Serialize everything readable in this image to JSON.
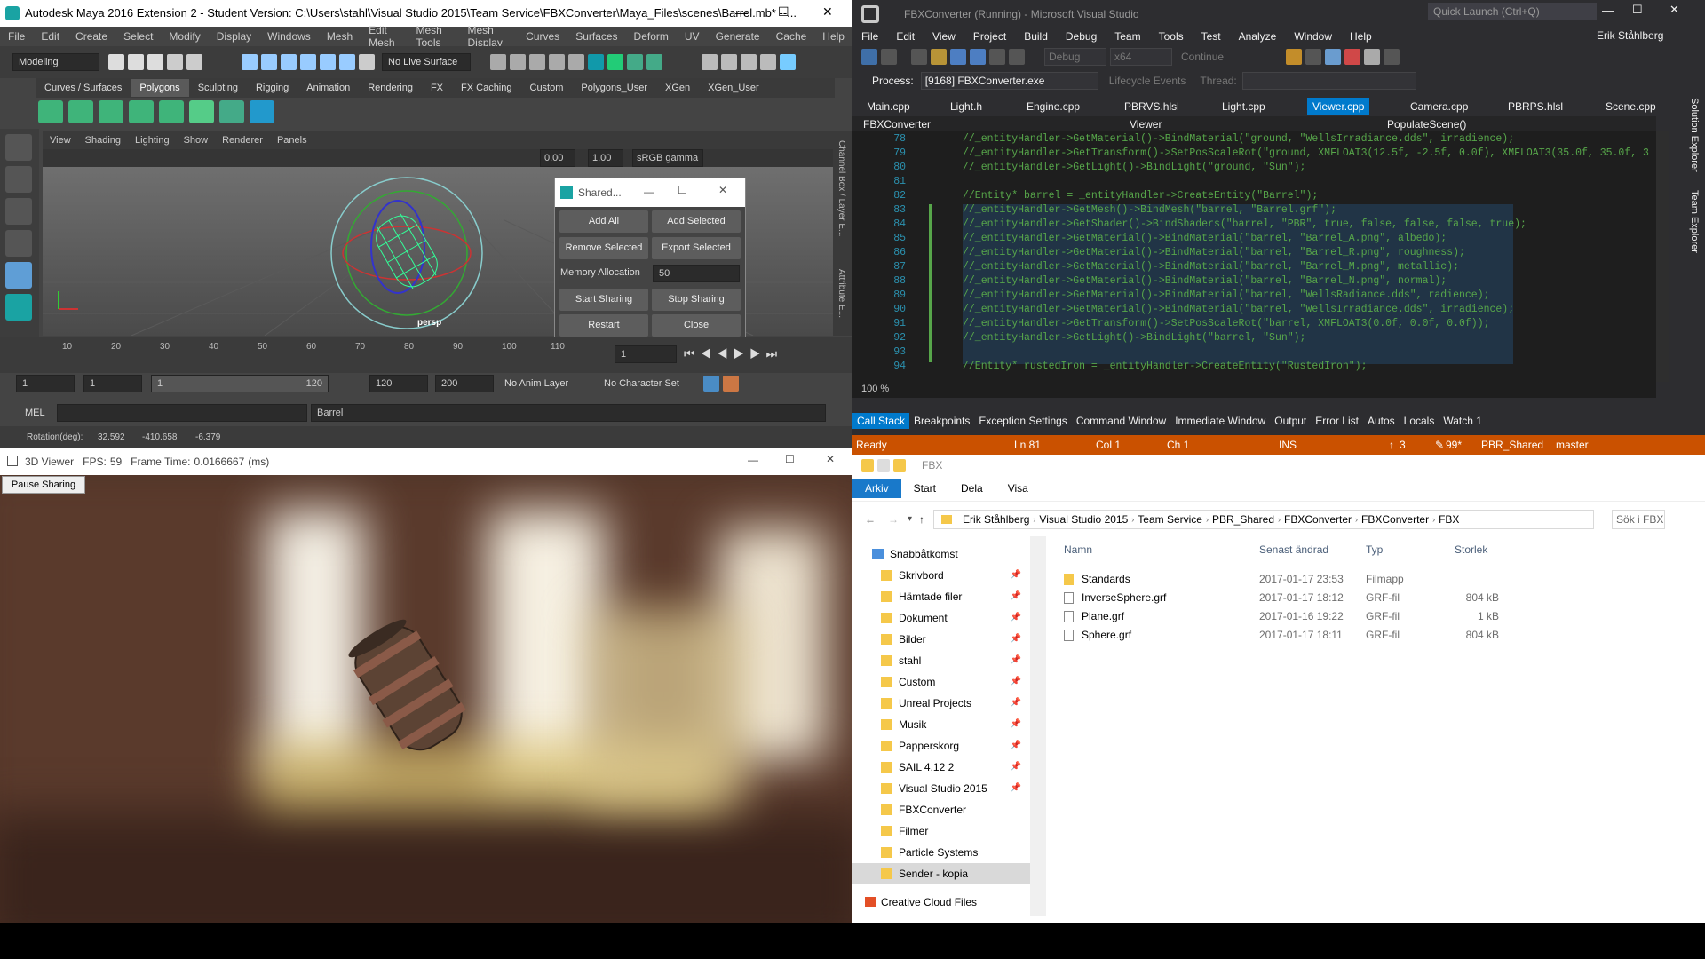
{
  "maya": {
    "title": "Autodesk Maya 2016 Extension 2 - Student Version: C:\\Users\\stahl\\Visual Studio 2015\\Team Service\\FBXConverter\\Maya_Files\\scenes\\Barrel.mb* --...",
    "menu": [
      "File",
      "Edit",
      "Create",
      "Select",
      "Modify",
      "Display",
      "Windows",
      "Mesh",
      "Edit Mesh",
      "Mesh Tools",
      "Mesh Display",
      "Curves",
      "Surfaces",
      "Deform",
      "UV",
      "Generate",
      "Cache",
      "Help"
    ],
    "mode": "Modeling",
    "live_surface": "No Live Surface",
    "shelf_tabs": [
      "Curves / Surfaces",
      "Polygons",
      "Sculpting",
      "Rigging",
      "Animation",
      "Rendering",
      "FX",
      "FX Caching",
      "Custom",
      "Polygons_User",
      "XGen",
      "XGen_User"
    ],
    "viewport_menu": [
      "View",
      "Shading",
      "Lighting",
      "Show",
      "Renderer",
      "Panels"
    ],
    "vp_value1": "0.00",
    "vp_value2": "1.00",
    "color_space": "sRGB gamma",
    "camera_label": "persp",
    "side_labels": [
      "Channel Box / Layer E...",
      "Attribute E..."
    ],
    "timeline_ticks": [
      "10",
      "20",
      "30",
      "40",
      "50",
      "60",
      "70",
      "80",
      "90",
      "100",
      "110"
    ],
    "current_frame": "1",
    "range_start": "1",
    "range_start2": "1",
    "range_slider_start": "1",
    "range_slider_end": "120",
    "range_end": "120",
    "range_end2": "200",
    "anim_layer": "No Anim Layer",
    "character_set": "No Character Set",
    "mel_label": "MEL",
    "mel_output": "Barrel",
    "help_line": {
      "label": "Rotation(deg):",
      "x": "32.592",
      "y": "-410.658",
      "z": "-6.379"
    }
  },
  "dialog": {
    "title": "Shared...",
    "add_all": "Add All",
    "add_selected": "Add Selected",
    "remove_selected": "Remove Selected",
    "export_selected": "Export Selected",
    "memory_label": "Memory Allocation",
    "memory_value": "50",
    "start_sharing": "Start Sharing",
    "stop_sharing": "Stop Sharing",
    "restart": "Restart",
    "close": "Close"
  },
  "viewer": {
    "title": "3D Viewer",
    "fps_label": "FPS:",
    "fps": "59",
    "frame_time_label": "Frame Time:",
    "frame_time": "0.0166667",
    "frame_unit": "(ms)",
    "pause_button": "Pause Sharing"
  },
  "vs": {
    "title": "FBXConverter (Running) - Microsoft Visual Studio",
    "quick_launch": "Quick Launch (Ctrl+Q)",
    "menu": [
      "File",
      "Edit",
      "View",
      "Project",
      "Build",
      "Debug",
      "Team",
      "Tools",
      "Test",
      "Analyze",
      "Window",
      "Help"
    ],
    "user": "Erik Ståhlberg",
    "config": "Debug",
    "platform": "x64",
    "continue": "Continue",
    "process_label": "Process:",
    "process": "[9168] FBXConverter.exe",
    "lifecycle": "Lifecycle Events",
    "thread_label": "Thread:",
    "tabs": [
      "Main.cpp",
      "Light.h",
      "Engine.cpp",
      "PBRVS.hlsl",
      "Light.cpp",
      "Viewer.cpp",
      "Camera.cpp",
      "PBRPS.hlsl",
      "Scene.cpp"
    ],
    "active_tab": "Viewer.cpp",
    "nav_project": "FBXConverter",
    "nav_class": "Viewer",
    "nav_member": "PopulateScene()",
    "side_tabs": [
      "Solution Explorer",
      "Team Explorer"
    ],
    "code_lines": [
      {
        "n": "78",
        "t": "//_entityHandler->GetMaterial()->BindMaterial(\"ground, \"WellsIrradiance.dds\", irradience);"
      },
      {
        "n": "79",
        "t": "//_entityHandler->GetTransform()->SetPosScaleRot(\"ground, XMFLOAT3(12.5f, -2.5f, 0.0f), XMFLOAT3(35.0f, 35.0f, 3"
      },
      {
        "n": "80",
        "t": "//_entityHandler->GetLight()->BindLight(\"ground, \"Sun\");"
      },
      {
        "n": "81",
        "t": ""
      },
      {
        "n": "82",
        "t": "//Entity* barrel = _entityHandler->CreateEntity(\"Barrel\");"
      },
      {
        "n": "83",
        "t": "//_entityHandler->GetMesh()->BindMesh(\"barrel, \"Barrel.grf\");"
      },
      {
        "n": "84",
        "t": "//_entityHandler->GetShader()->BindShaders(\"barrel, \"PBR\", true, false, false, false, true);"
      },
      {
        "n": "85",
        "t": "//_entityHandler->GetMaterial()->BindMaterial(\"barrel, \"Barrel_A.png\", albedo);"
      },
      {
        "n": "86",
        "t": "//_entityHandler->GetMaterial()->BindMaterial(\"barrel, \"Barrel_R.png\", roughness);"
      },
      {
        "n": "87",
        "t": "//_entityHandler->GetMaterial()->BindMaterial(\"barrel, \"Barrel_M.png\", metallic);"
      },
      {
        "n": "88",
        "t": "//_entityHandler->GetMaterial()->BindMaterial(\"barrel, \"Barrel_N.png\", normal);"
      },
      {
        "n": "89",
        "t": "//_entityHandler->GetMaterial()->BindMaterial(\"barrel, \"WellsRadiance.dds\", radience);"
      },
      {
        "n": "90",
        "t": "//_entityHandler->GetMaterial()->BindMaterial(\"barrel, \"WellsIrradiance.dds\", irradience);"
      },
      {
        "n": "91",
        "t": "//_entityHandler->GetTransform()->SetPosScaleRot(\"barrel, XMFLOAT3(0.0f, 0.0f, 0.0f));"
      },
      {
        "n": "92",
        "t": "//_entityHandler->GetLight()->BindLight(\"barrel, \"Sun\");"
      },
      {
        "n": "93",
        "t": ""
      },
      {
        "n": "94",
        "t": "//Entity* rustedIron = _entityHandler->CreateEntity(\"RustedIron\");"
      }
    ],
    "zoom": "100 %",
    "tool_tabs": [
      "Call Stack",
      "Breakpoints",
      "Exception Settings",
      "Command Window",
      "Immediate Window",
      "Output",
      "Error List",
      "Autos",
      "Locals",
      "Watch 1"
    ],
    "status": {
      "ready": "Ready",
      "ln": "Ln 81",
      "col": "Col 1",
      "ch": "Ch 1",
      "ins": "INS",
      "up": "3",
      "edits": "99*",
      "repo": "PBR_Shared",
      "branch": "master"
    }
  },
  "explorer": {
    "title": "FBX",
    "ribbon": [
      "Arkiv",
      "Start",
      "Dela",
      "Visa"
    ],
    "path": [
      "Erik Ståhlberg",
      "Visual Studio 2015",
      "Team Service",
      "PBR_Shared",
      "FBXConverter",
      "FBXConverter",
      "FBX"
    ],
    "search": "Sök i FBX",
    "nav": [
      "Snabbåtkomst",
      "Skrivbord",
      "Hämtade filer",
      "Dokument",
      "Bilder",
      "stahl",
      "Custom",
      "Unreal Projects",
      "Musik",
      "Papperskorg",
      "SAIL 4.12 2",
      "Visual Studio 2015",
      "FBXConverter",
      "Filmer",
      "Particle Systems",
      "Sender - kopia",
      "Creative Cloud Files"
    ],
    "columns": [
      "Namn",
      "Senast ändrad",
      "Typ",
      "Storlek"
    ],
    "files": [
      {
        "name": "Standards",
        "date": "2017-01-17 23:53",
        "type": "Filmapp",
        "size": ""
      },
      {
        "name": "InverseSphere.grf",
        "date": "2017-01-17 18:12",
        "type": "GRF-fil",
        "size": "804 kB"
      },
      {
        "name": "Plane.grf",
        "date": "2017-01-16 19:22",
        "type": "GRF-fil",
        "size": "1 kB"
      },
      {
        "name": "Sphere.grf",
        "date": "2017-01-17 18:11",
        "type": "GRF-fil",
        "size": "804 kB"
      }
    ]
  }
}
